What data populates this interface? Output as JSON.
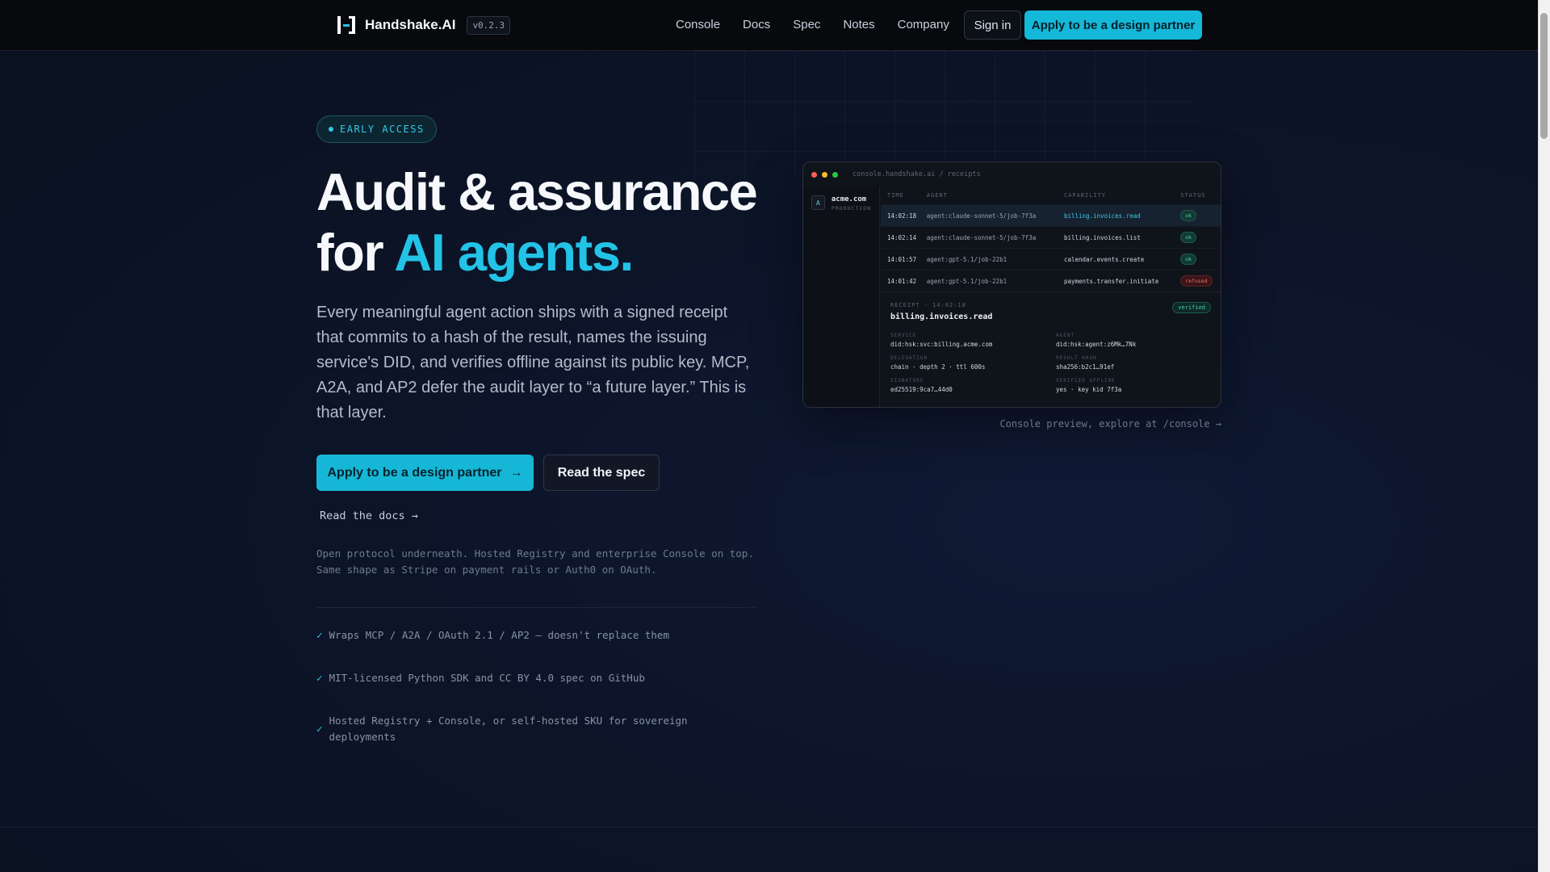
{
  "nav": {
    "brand": "Handshake.AI",
    "version": "v0.2.3",
    "links": [
      "Console",
      "Docs",
      "Spec",
      "Notes",
      "Company"
    ],
    "signin": "Sign in",
    "cta": "Apply to be a design partner"
  },
  "hero": {
    "badge": "EARLY ACCESS",
    "headline_line1": "Audit & assurance",
    "headline_for": "for ",
    "headline_accent": "AI agents.",
    "lede": "Every meaningful agent action ships with a signed receipt that commits to a hash of the result, names the issuing service's DID, and verifies offline against its public key. MCP, A2A, and AP2 defer the audit layer to “a future layer.” This is that layer.",
    "primary_button": "Apply to be a design partner",
    "primary_arrow": "→",
    "secondary_button": "Read the spec",
    "docs_link": "Read the docs →",
    "subnote": "Open protocol underneath. Hosted Registry and enterprise Console on top. Same shape as Stripe on payment rails or Auth0 on OAuth.",
    "checks": [
      "Wraps MCP / A2A / OAuth 2.1 / AP2 — doesn't replace them",
      "MIT-licensed Python SDK and CC BY 4.0 spec on GitHub",
      "Hosted Registry + Console, or self-hosted SKU for sovereign deployments"
    ],
    "check_mark": "✓"
  },
  "console": {
    "url": "console.handshake.ai / receipts",
    "tenant_initial": "A",
    "tenant_name": "acme.com",
    "tenant_env": "PRODUCTION",
    "columns": [
      "TIME",
      "AGENT",
      "CAPABILITY",
      "STATUS"
    ],
    "rows": [
      {
        "time": "14:02:18",
        "agent": "agent:claude-sonnet-5/job-7f3a",
        "capability": "billing.invoices.read",
        "status": "ok"
      },
      {
        "time": "14:02:14",
        "agent": "agent:claude-sonnet-5/job-7f3a",
        "capability": "billing.invoices.list",
        "status": "ok"
      },
      {
        "time": "14:01:57",
        "agent": "agent:gpt-5.1/job-22b1",
        "capability": "calendar.events.create",
        "status": "ok"
      },
      {
        "time": "14:01:42",
        "agent": "agent:gpt-5.1/job-22b1",
        "capability": "payments.transfer.initiate",
        "status": "refused"
      }
    ],
    "receipt": {
      "label": "RECEIPT · 14:02:18",
      "title": "billing.invoices.read",
      "verified": "verified",
      "fields": [
        {
          "k": "SERVICE",
          "v": "did:hsk:svc:billing.acme.com"
        },
        {
          "k": "AGENT",
          "v": "did:hsk:agent:z6Mk…7Nk"
        },
        {
          "k": "DELEGATION",
          "v": "chain · depth 2 · ttl 600s"
        },
        {
          "k": "RESULT HASH",
          "v": "sha256:b2c1…91ef"
        },
        {
          "k": "SIGNATURE",
          "v": "ed25519:9ca7…44d0"
        },
        {
          "k": "VERIFIED OFFLINE",
          "v": "yes · key kid 7f3a"
        }
      ]
    },
    "caption": "Console preview, explore at /console →"
  },
  "colors": {
    "accent": "#22c3e6",
    "ok": "#41d0a8",
    "refused": "#f06b6b",
    "dot_red": "#ff5f57",
    "dot_yellow": "#febc2e",
    "dot_green": "#28c840"
  }
}
